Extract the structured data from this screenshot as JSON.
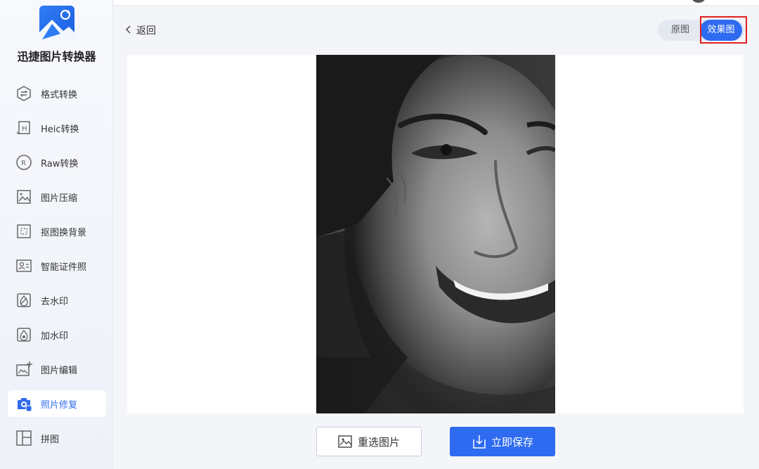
{
  "app": {
    "title": "迅捷图片转换器",
    "brand_color": "#2f6bf0"
  },
  "sidebar": {
    "items": [
      {
        "label": "格式转换",
        "icon": "format-convert-icon",
        "active": false
      },
      {
        "label": "Heic转换",
        "icon": "heic-icon",
        "active": false
      },
      {
        "label": "Raw转换",
        "icon": "raw-icon",
        "active": false
      },
      {
        "label": "图片压缩",
        "icon": "image-compress-icon",
        "active": false
      },
      {
        "label": "抠图换背景",
        "icon": "cutout-icon",
        "active": false
      },
      {
        "label": "智能证件照",
        "icon": "id-photo-icon",
        "active": false
      },
      {
        "label": "去水印",
        "icon": "remove-watermark-icon",
        "active": false
      },
      {
        "label": "加水印",
        "icon": "add-watermark-icon",
        "active": false
      },
      {
        "label": "图片编辑",
        "icon": "image-edit-icon",
        "active": false
      },
      {
        "label": "照片修复",
        "icon": "photo-repair-icon",
        "active": true
      },
      {
        "label": "拼图",
        "icon": "collage-icon",
        "active": false
      }
    ]
  },
  "header": {
    "back_label": "返回"
  },
  "view_toggle": {
    "original_label": "原图",
    "result_label": "效果图",
    "selected": "效果图"
  },
  "preview": {
    "image": "black-and-white smiling face photo"
  },
  "actions": {
    "reselect_label": "重选图片",
    "save_label": "立即保存"
  }
}
